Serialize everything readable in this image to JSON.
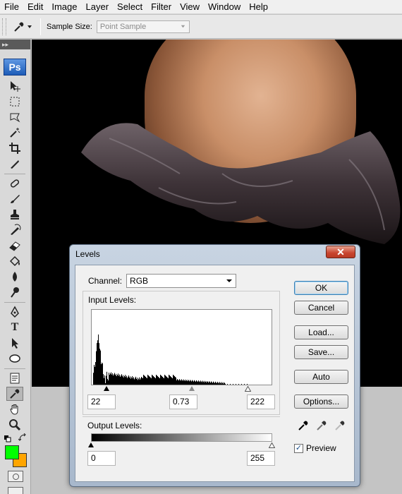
{
  "menu": [
    "File",
    "Edit",
    "Image",
    "Layer",
    "Select",
    "Filter",
    "View",
    "Window",
    "Help"
  ],
  "options_bar": {
    "sample_size_label": "Sample Size:",
    "sample_size_value": "Point Sample",
    "tool_icon": "eyedropper-icon"
  },
  "toolbox": {
    "header": "▸▸",
    "logo": "Ps",
    "tools": [
      "move-icon",
      "marquee-icon",
      "lasso-icon",
      "magic-wand-icon",
      "crop-icon",
      "slice-icon",
      "healing-brush-icon",
      "brush-icon",
      "clone-stamp-icon",
      "history-brush-icon",
      "eraser-icon",
      "paint-bucket-icon",
      "blur-icon",
      "dodge-icon",
      "pen-icon",
      "type-icon",
      "path-selection-icon",
      "shape-icon",
      "notes-icon",
      "eyedropper-icon",
      "hand-icon",
      "zoom-icon"
    ],
    "foreground_color": "#00ff00",
    "background_color": "#ffa500"
  },
  "dialog": {
    "title": "Levels",
    "close": "✕",
    "channel_label": "Channel:",
    "channel_value": "RGB",
    "input_levels_label": "Input Levels:",
    "input_black": "22",
    "input_gamma": "0.73",
    "input_white": "222",
    "output_levels_label": "Output Levels:",
    "output_black": "0",
    "output_white": "255",
    "buttons": {
      "ok": "OK",
      "cancel": "Cancel",
      "load": "Load...",
      "save": "Save...",
      "auto": "Auto",
      "options": "Options..."
    },
    "preview_label": "Preview",
    "preview_checked": true,
    "eyedroppers": [
      "black-eyedropper-icon",
      "gray-eyedropper-icon",
      "white-eyedropper-icon"
    ]
  }
}
